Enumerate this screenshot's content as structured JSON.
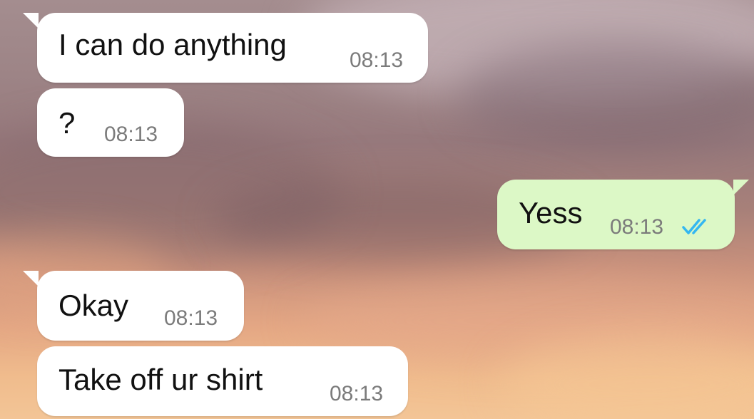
{
  "messages": [
    {
      "direction": "incoming",
      "text": "I can do anything",
      "time": "08:13"
    },
    {
      "direction": "incoming",
      "text": "?",
      "time": "08:13"
    },
    {
      "direction": "outgoing",
      "text": "Yess",
      "time": "08:13",
      "status": "read",
      "status_icon": "double-check-icon",
      "status_color": "#34b7f1"
    },
    {
      "direction": "incoming",
      "text": "Okay",
      "time": "08:13"
    },
    {
      "direction": "incoming",
      "text": "Take off ur shirt",
      "time": "08:13"
    }
  ],
  "colors": {
    "incoming_bubble": "#ffffff",
    "outgoing_bubble": "#dcf8c6",
    "timestamp": "#7b7b7b",
    "read_ticks": "#34b7f1"
  }
}
